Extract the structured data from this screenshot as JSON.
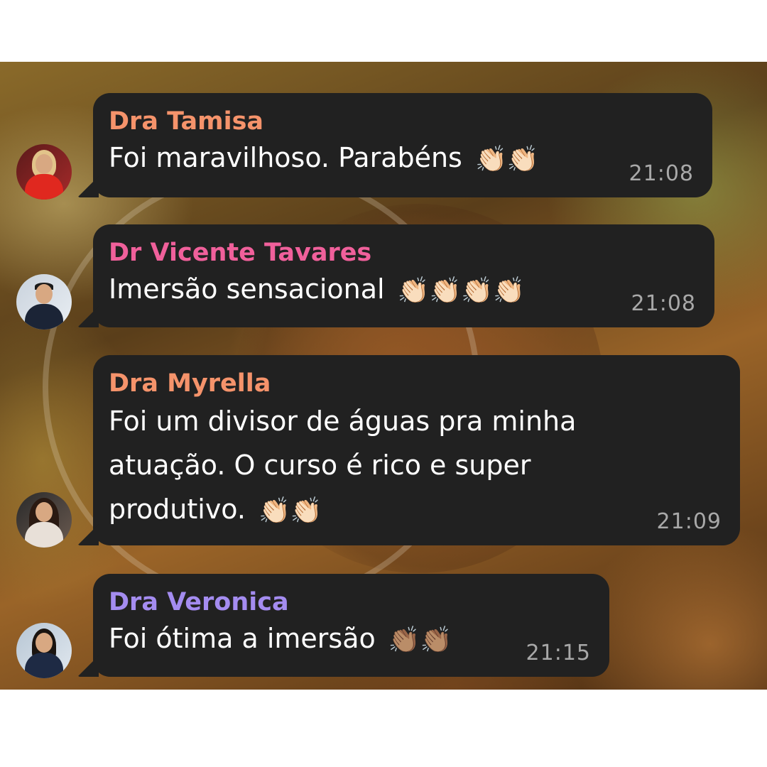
{
  "messages": [
    {
      "sender": "Dra Tamisa",
      "sender_color": "#f5936b",
      "text": "Foi maravilhoso. Parabéns",
      "emoji": "👏🏻👏🏻",
      "time": "21:08"
    },
    {
      "sender": "Dr Vicente Tavares",
      "sender_color": "#f0609b",
      "text": "Imersão sensacional",
      "emoji": "👏🏻👏🏻👏🏻👏🏻",
      "time": "21:08"
    },
    {
      "sender": "Dra Myrella",
      "sender_color": "#f5936b",
      "text": "Foi um divisor de águas pra minha\natuação. O curso é rico e super\nprodutivo.",
      "emoji": "👏🏻👏🏻",
      "time": "21:09"
    },
    {
      "sender": "Dra Veronica",
      "sender_color": "#a48cf0",
      "text": "Foi ótima a imersão",
      "emoji": "👏🏽👏🏽",
      "time": "21:15"
    }
  ]
}
